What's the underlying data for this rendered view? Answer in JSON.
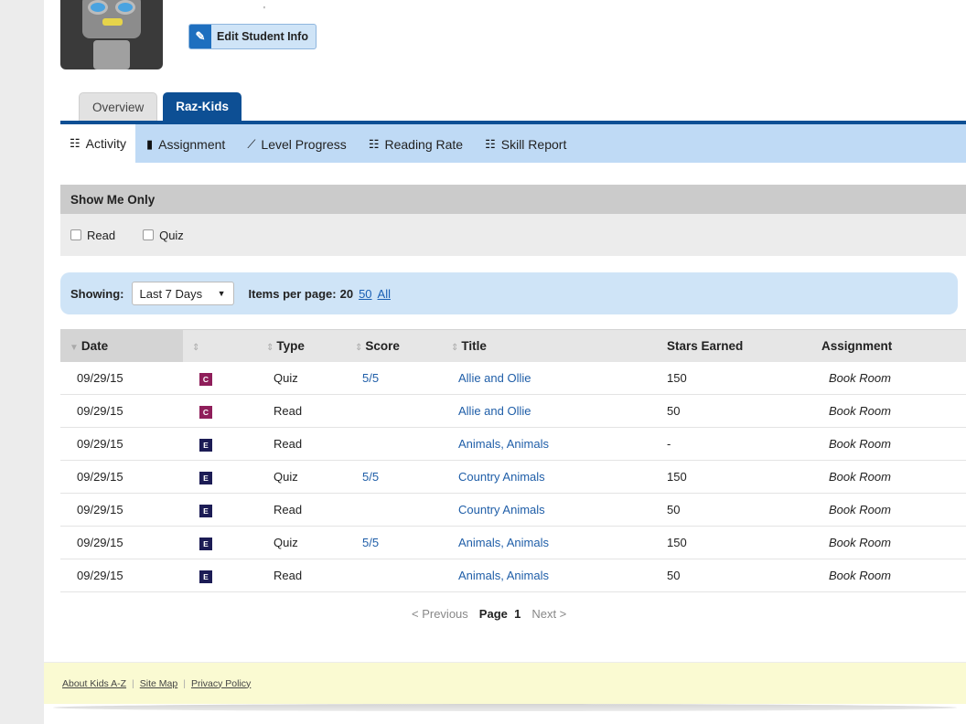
{
  "header": {
    "edit_label": "Edit Student Info",
    "dot": "'"
  },
  "tabs": [
    {
      "label": "Overview"
    },
    {
      "label": "Raz-Kids"
    }
  ],
  "subnav": [
    {
      "label": "Activity"
    },
    {
      "label": "Assignment"
    },
    {
      "label": "Level Progress"
    },
    {
      "label": "Reading Rate"
    },
    {
      "label": "Skill Report"
    }
  ],
  "filter": {
    "title": "Show Me Only",
    "options": [
      "Read",
      "Quiz"
    ]
  },
  "showing": {
    "label": "Showing:",
    "selected": "Last 7 Days",
    "items_label": "Items per page:",
    "current": "20",
    "opt50": "50",
    "optall": "All"
  },
  "table": {
    "headers": [
      "Date",
      "",
      "Type",
      "Score",
      "Title",
      "Stars Earned",
      "Assignment"
    ],
    "rows": [
      {
        "date": "09/29/15",
        "level": "C",
        "type": "Quiz",
        "score": "5/5",
        "title": "Allie and Ollie",
        "stars": "150",
        "assignment": "Book Room"
      },
      {
        "date": "09/29/15",
        "level": "C",
        "type": "Read",
        "score": "",
        "title": "Allie and Ollie",
        "stars": "50",
        "assignment": "Book Room"
      },
      {
        "date": "09/29/15",
        "level": "E",
        "type": "Read",
        "score": "",
        "title": "Animals, Animals",
        "stars": "-",
        "assignment": "Book Room"
      },
      {
        "date": "09/29/15",
        "level": "E",
        "type": "Quiz",
        "score": "5/5",
        "title": "Country Animals",
        "stars": "150",
        "assignment": "Book Room"
      },
      {
        "date": "09/29/15",
        "level": "E",
        "type": "Read",
        "score": "",
        "title": "Country Animals",
        "stars": "50",
        "assignment": "Book Room"
      },
      {
        "date": "09/29/15",
        "level": "E",
        "type": "Quiz",
        "score": "5/5",
        "title": "Animals, Animals",
        "stars": "150",
        "assignment": "Book Room"
      },
      {
        "date": "09/29/15",
        "level": "E",
        "type": "Read",
        "score": "",
        "title": "Animals, Animals",
        "stars": "50",
        "assignment": "Book Room"
      }
    ]
  },
  "pager": {
    "prev": "< Previous",
    "page_label": "Page",
    "page": "1",
    "next": "Next >"
  },
  "footer": {
    "links": [
      "About Kids A-Z",
      "Site Map",
      "Privacy Policy"
    ]
  },
  "colors": {
    "accent": "#0d4f94",
    "subnav": "#bfdaf5",
    "level_c": "#8f1e5a",
    "level_e": "#1c1c55"
  }
}
